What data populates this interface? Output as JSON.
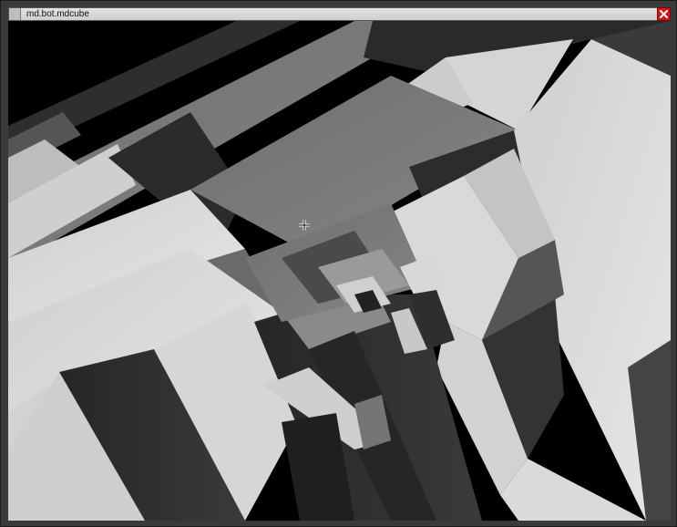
{
  "window": {
    "title": "md.bot.mdcube",
    "close_icon": "close-x-icon"
  },
  "viewport": {
    "content": "3d-render",
    "cursor_icon": "crosshair-icon"
  },
  "colors": {
    "close_button": "#d01818",
    "light_face": "#d9d9d9",
    "mid_face": "#7b7b7b",
    "dark_face": "#2f2f2f",
    "background": "#000000"
  }
}
